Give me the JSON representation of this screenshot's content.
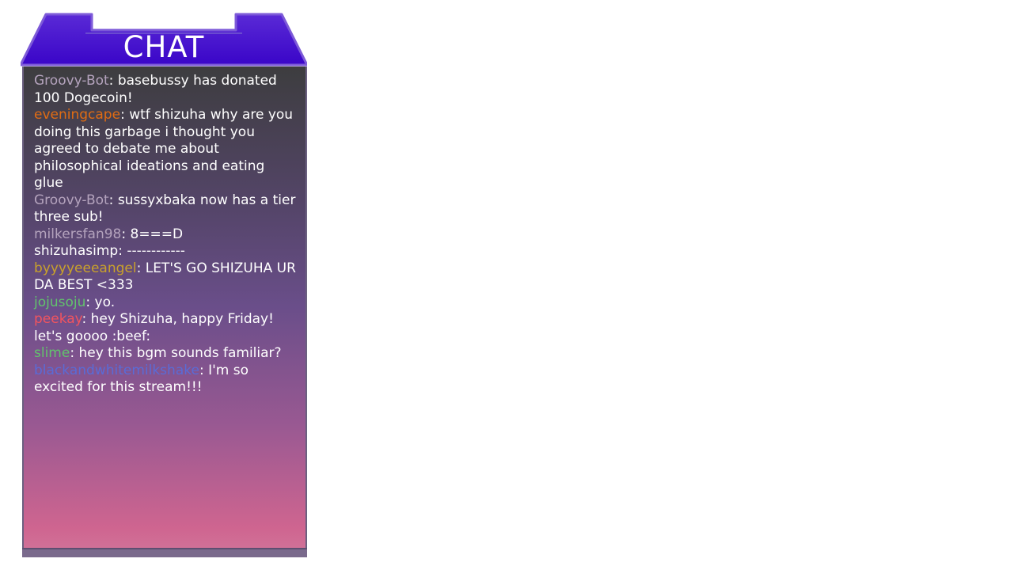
{
  "chat": {
    "title": "CHAT",
    "messages": [
      {
        "user": "Groovy-Bot",
        "color": "#b4a3bd",
        "text": "basebussy has donated 100 Dogecoin!"
      },
      {
        "user": "eveningcape",
        "color": "#e06c13",
        "text": "wtf shizuha why are you doing this garbage i thought you agreed to debate me about philosophical ideations and eating glue"
      },
      {
        "user": "Groovy-Bot",
        "color": "#b4a3bd",
        "text": "sussyxbaka now has a tier three sub!"
      },
      {
        "user": "milkersfan98",
        "color": "#b4a3bd",
        "text": "8===D"
      },
      {
        "user": "shizuhasimp",
        "color": "#ffffff",
        "text": "------------"
      },
      {
        "user": "byyyyeeeangel",
        "color": "#c9a12b",
        "text": "LET'S GO SHIZUHA UR DA BEST <333"
      },
      {
        "user": "jojusoju",
        "color": "#62c36c",
        "text": "yo."
      },
      {
        "user": "peekay",
        "color": "#f2545e",
        "text": "hey Shizuha, happy Friday! let's goooo :beef:"
      },
      {
        "user": "slime",
        "color": "#62c36c",
        "text": "hey this bgm sounds familiar?"
      },
      {
        "user": "blackandwhitemilkshake",
        "color": "#5a6bd6",
        "text": "I'm so excited for this stream!!!"
      }
    ]
  },
  "colors": {
    "header_top": "#5a2ad6",
    "header_bottom": "#3a05c8",
    "body_top": "#3d3d3f",
    "body_bottom": "#d07097"
  }
}
